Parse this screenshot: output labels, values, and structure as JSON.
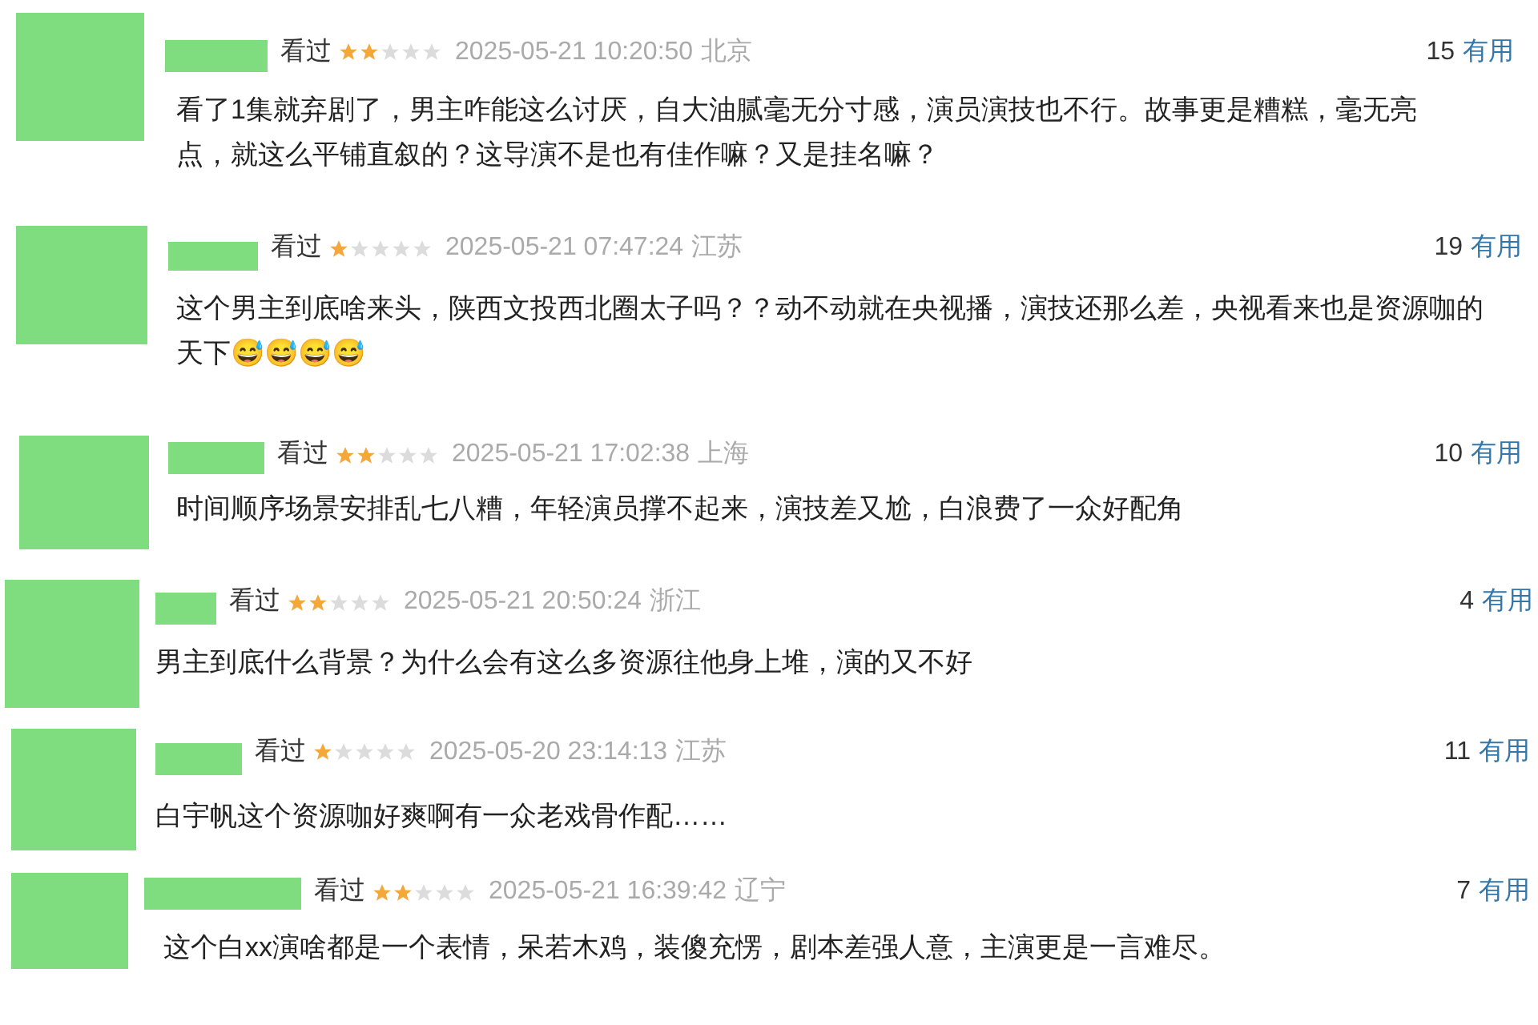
{
  "reviews": [
    {
      "status": "看过",
      "stars": 2,
      "time": "2025-05-21 10:20:50",
      "location": "北京",
      "votes": "15",
      "vote_label": "有用",
      "text": "看了1集就弃剧了，男主咋能这么讨厌，自大油腻毫无分寸感，演员演技也不行。故事更是糟糕，毫无亮点，就这么平铺直叙的？这导演不是也有佳作嘛？又是挂名嘛？"
    },
    {
      "status": "看过",
      "stars": 1,
      "time": "2025-05-21 07:47:24",
      "location": "江苏",
      "votes": "19",
      "vote_label": "有用",
      "text": "这个男主到底啥来头，陕西文投西北圈太子吗？？动不动就在央视播，演技还那么差，央视看来也是资源咖的天下",
      "emojis": [
        "😅",
        "😅",
        "😅",
        "😅"
      ]
    },
    {
      "status": "看过",
      "stars": 2,
      "time": "2025-05-21 17:02:38",
      "location": "上海",
      "votes": "10",
      "vote_label": "有用",
      "text": "时间顺序场景安排乱七八糟，年轻演员撑不起来，演技差又尬，白浪费了一众好配角"
    },
    {
      "status": "看过",
      "stars": 2,
      "time": "2025-05-21 20:50:24",
      "location": "浙江",
      "votes": "4",
      "vote_label": "有用",
      "text": "男主到底什么背景？为什么会有这么多资源往他身上堆，演的又不好"
    },
    {
      "status": "看过",
      "stars": 1,
      "time": "2025-05-20 23:14:13",
      "location": "江苏",
      "votes": "11",
      "vote_label": "有用",
      "text": "白宇帆这个资源咖好爽啊有一众老戏骨作配……"
    },
    {
      "status": "看过",
      "stars": 2,
      "time": "2025-05-21 16:39:42",
      "location": "辽宁",
      "votes": "7",
      "vote_label": "有用",
      "text": "这个白xx演啥都是一个表情，呆若木鸡，装傻充愣，剧本差强人意，主演更是一言难尽。"
    }
  ]
}
